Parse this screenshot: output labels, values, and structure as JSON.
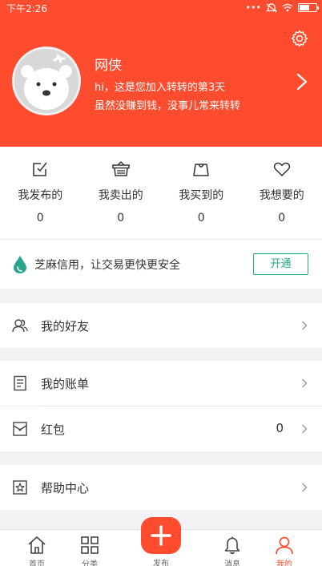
{
  "status_bar": {
    "time": "下午2:26",
    "dots": "•••"
  },
  "profile": {
    "nickname": "网侠",
    "greeting_line1": "hi，这是您加入转转的第3天",
    "greeting_line2": "虽然没赚到钱，没事儿常来转转"
  },
  "stats": [
    {
      "label": "我发布的",
      "count": "0",
      "icon": "edit-box-icon"
    },
    {
      "label": "我卖出的",
      "count": "0",
      "icon": "basket-icon"
    },
    {
      "label": "我买到的",
      "count": "0",
      "icon": "shopping-bag-icon"
    },
    {
      "label": "我想要的",
      "count": "0",
      "icon": "heart-icon"
    }
  ],
  "zhima": {
    "text": "芝麻信用，让交易更快更安全",
    "button": "开通"
  },
  "menu": {
    "friends": "我的好友",
    "bill": "我的账单",
    "redpacket": "红包",
    "redpacket_count": "0",
    "help": "帮助中心"
  },
  "tabs": {
    "home": "首页",
    "category": "分类",
    "publish": "发布",
    "messages": "消息",
    "me": "我的"
  },
  "colors": {
    "brand": "#ff4c2f",
    "zhima_green": "#27a58d"
  }
}
